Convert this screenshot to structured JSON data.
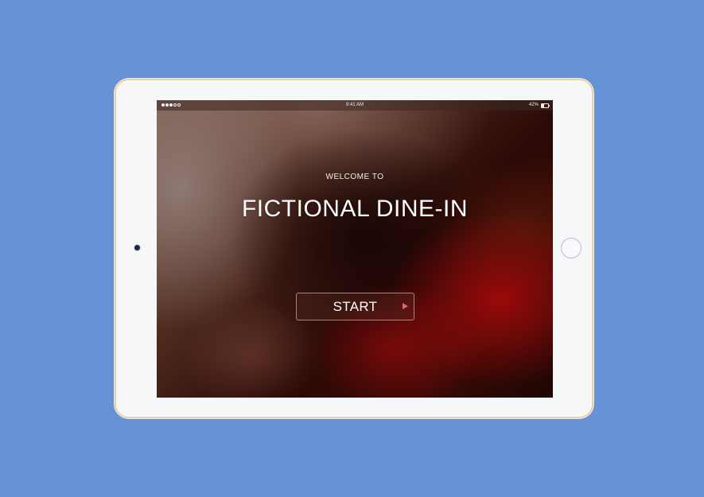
{
  "status_bar": {
    "time": "9:41 AM",
    "battery_text": "42%",
    "battery_level": 0.42,
    "signal_bars_filled": 3,
    "signal_bars_total": 5
  },
  "welcome_screen": {
    "welcome_text": "WELCOME TO",
    "app_title": "FICTIONAL DINE-IN",
    "start_label": "START"
  },
  "colors": {
    "page_background": "#6593d6",
    "device_frame": "#f6f7f9",
    "device_trim": "#e6c9a3",
    "play_icon": "#e06a6a"
  },
  "icons": {
    "start_button_icon": "play-triangle-icon",
    "battery": "battery-icon",
    "signal": "signal-dots-icon",
    "camera": "front-camera",
    "home": "home-button"
  }
}
